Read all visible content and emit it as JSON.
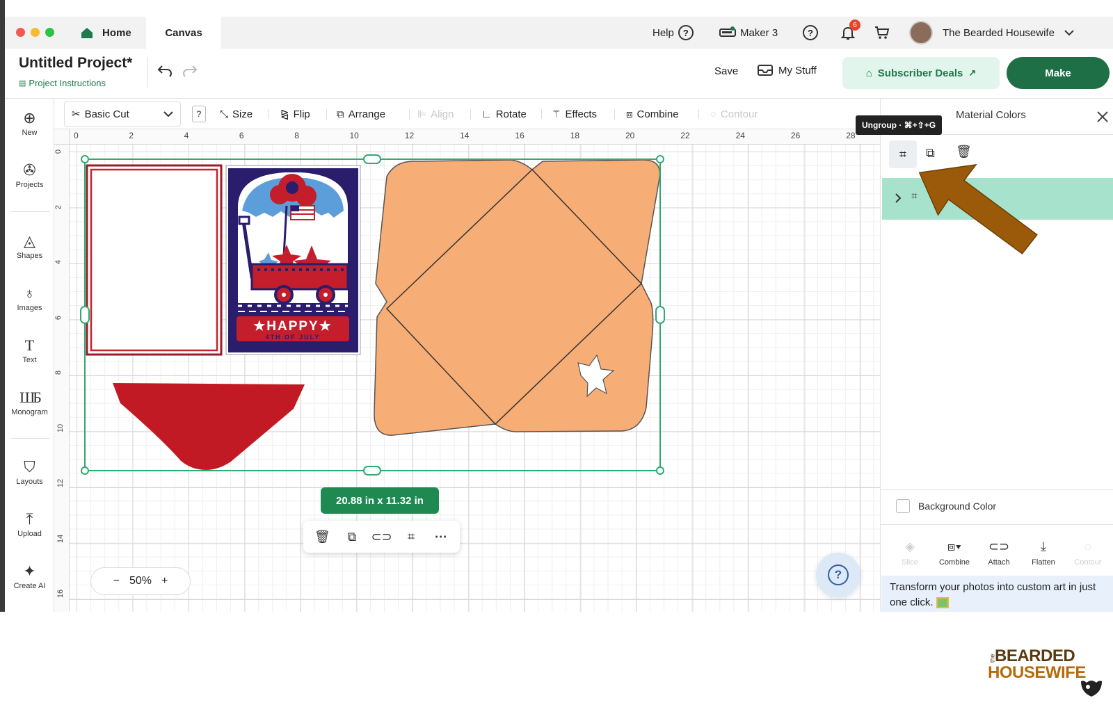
{
  "window": {
    "tabs": [
      {
        "label": "Home"
      },
      {
        "label": "Canvas"
      }
    ],
    "help_label": "Help",
    "machine_label": "Maker 3",
    "notification_count": "6",
    "user_name": "The Bearded Housewife"
  },
  "project": {
    "title": "Untitled Project*",
    "instructions_link": "Project Instructions",
    "save_label": "Save",
    "my_stuff_label": "My Stuff",
    "subscriber_deals_label": "Subscriber Deals",
    "make_label": "Make"
  },
  "toolbar": {
    "operation": "Basic Cut",
    "info_label": "?",
    "size": "Size",
    "flip": "Flip",
    "arrange": "Arrange",
    "align": "Align",
    "rotate": "Rotate",
    "effects": "Effects",
    "combine": "Combine",
    "contour": "Contour"
  },
  "leftnav": [
    {
      "label": "New",
      "icon": "plus-circle-icon"
    },
    {
      "label": "Projects",
      "icon": "projects-icon"
    },
    {
      "label": "Shapes",
      "icon": "shapes-icon"
    },
    {
      "label": "Images",
      "icon": "lightbulb-icon"
    },
    {
      "label": "Text",
      "icon": "text-icon"
    },
    {
      "label": "Monogram",
      "icon": "monogram-icon"
    },
    {
      "label": "Layouts",
      "icon": "shirt-icon"
    },
    {
      "label": "Upload",
      "icon": "upload-icon"
    },
    {
      "label": "Create AI",
      "icon": "sparkle-icon"
    }
  ],
  "ruler": {
    "x_labels": [
      "0",
      "2",
      "4",
      "6",
      "8",
      "10",
      "12",
      "14",
      "16",
      "18",
      "20",
      "22",
      "24",
      "26",
      "28"
    ],
    "y_labels": [
      "0",
      "2",
      "4",
      "6",
      "8",
      "10",
      "12",
      "14",
      "16"
    ]
  },
  "canvas": {
    "selection_size": "20.88  in x 11.32  in",
    "card_text_main": "★HAPPY★",
    "card_text_sub": "4TH OF JULY",
    "zoom": "50%",
    "zoom_minus": "−",
    "zoom_plus": "+"
  },
  "panel": {
    "tooltip": "Ungroup · ⌘+⇧+G",
    "tab_material_colors": "Material Colors",
    "background_color_label": "Background Color",
    "bottom_actions": [
      "Slice",
      "Combine",
      "Attach",
      "Flatten",
      "Contour"
    ],
    "promo_text": "Transform your photos into custom art in just one click."
  },
  "brand": {
    "small": "the",
    "line1": "BEARDED",
    "line2": "HOUSEWIFE"
  },
  "colors": {
    "accent_green": "#1e7a4a",
    "selection_green": "#2eaa72",
    "layer_highlight": "#a7e3cc",
    "arrow_brown": "#9a5a09"
  }
}
